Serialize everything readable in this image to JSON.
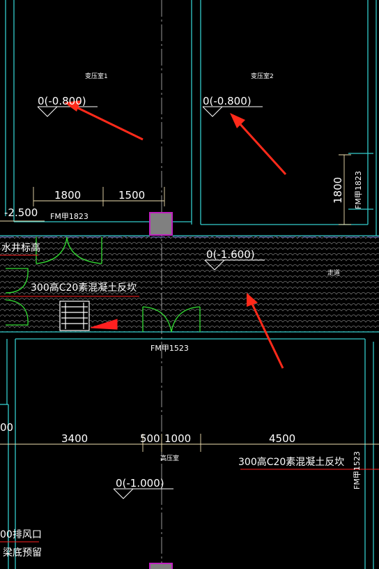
{
  "colors": {
    "background": "#000000",
    "wall": "#33cccc",
    "dimension": "#f0e0b0",
    "door": "#33dd33",
    "annotation_red": "#ff2020",
    "text": "#ffffff",
    "hatch": "#6f6f6f",
    "column": "#808080",
    "column_border": "#c020c0",
    "arrow": "#ff2a1a"
  },
  "rooms": {
    "transformer_1": "变压室1",
    "transformer_2": "变压室2",
    "corridor": "走道",
    "hv_room": "高压室"
  },
  "elevations": {
    "t1": "0(-0.800)",
    "t2": "0(-0.800)",
    "corridor": "0(-1.600)",
    "hv": "0(-1.000)",
    "left_partial": "-2.500"
  },
  "doors": {
    "d1": "FM甲1823",
    "d2": "FM甲1823",
    "d3": "FM甲1523",
    "d4": "FM甲1523"
  },
  "dimensions": {
    "top_left": "1800",
    "top_right": "1500",
    "vertical_right": "1800",
    "bottom_a": "3400",
    "bottom_b": "500",
    "bottom_c": "1000",
    "bottom_d": "4500",
    "left_partial": "00"
  },
  "notes": {
    "curb_1": "300高C20素混凝土反坎",
    "curb_2": "300高C20素混凝土反坎",
    "well_mark": "水井标高",
    "exhaust": "00排风口",
    "beam_reserve": "梁底预留"
  }
}
